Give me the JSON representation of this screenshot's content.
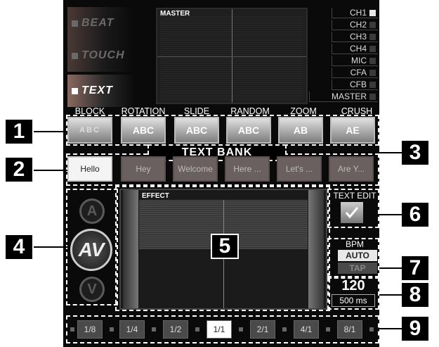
{
  "modes": [
    "BEAT",
    "TOUCH",
    "TEXT"
  ],
  "master": {
    "label": "MASTER"
  },
  "channels": [
    "CH1",
    "CH2",
    "CH3",
    "CH4",
    "MIC",
    "CFA",
    "CFB",
    "MASTER"
  ],
  "effects": [
    "BLOCK",
    "ROTATION",
    "SLIDE",
    "RANDOM",
    "ZOOM",
    "CRUSH"
  ],
  "effect_tiles": [
    "ABC",
    "ABC",
    "ABC",
    "ABC",
    "AB",
    "AE"
  ],
  "text_bank": {
    "title": "TEXT BANK",
    "words": [
      "Hello",
      "Hey",
      "Welcome",
      "Here ...",
      "Let's ...",
      "Are Y..."
    ]
  },
  "speed": {
    "up": "A",
    "current": "AV",
    "down": "V"
  },
  "effect_display": {
    "label": "EFFECT"
  },
  "text_edit": {
    "label": "TEXT EDIT"
  },
  "bpm": {
    "label": "BPM",
    "auto": "AUTO",
    "tap": "TAP",
    "value": "120",
    "ms": "500 ms"
  },
  "steps": [
    "1/8",
    "1/4",
    "1/2",
    "1/1",
    "2/1",
    "4/1",
    "8/1"
  ],
  "callouts": [
    "1",
    "2",
    "3",
    "4",
    "5",
    "6",
    "7",
    "8",
    "9"
  ]
}
